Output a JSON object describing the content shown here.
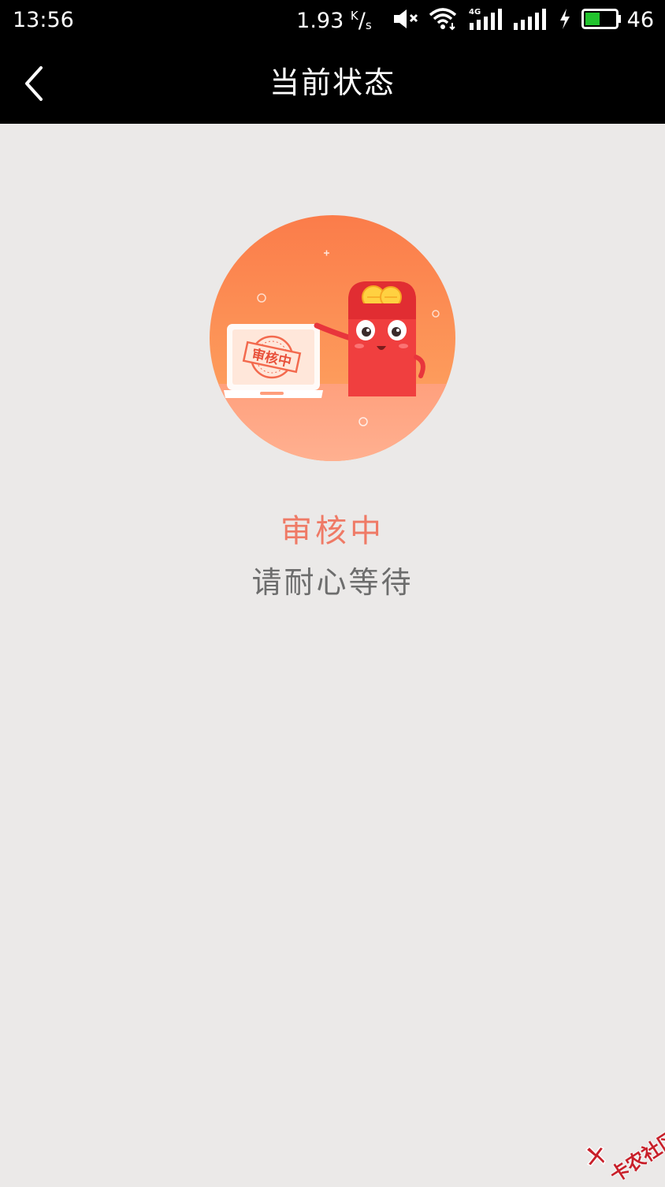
{
  "status_bar": {
    "time": "13:56",
    "net_speed_value": "1.93",
    "net_speed_unit_top": "K",
    "net_speed_unit_bottom": "s",
    "network_type": "4G",
    "battery_percent": "46"
  },
  "nav": {
    "title": "当前状态"
  },
  "illustration": {
    "stamp_text": "审核中"
  },
  "review": {
    "status": "审核中",
    "message": "请耐心等待"
  },
  "watermark": {
    "text": "卡农社区"
  },
  "colors": {
    "status_accent": "#ef7a66",
    "background": "#ebe9e8",
    "bar": "#000000"
  }
}
